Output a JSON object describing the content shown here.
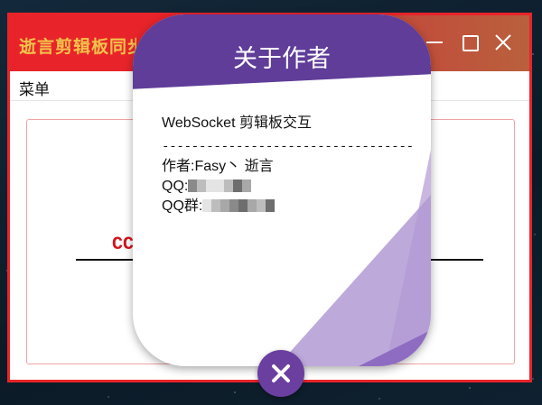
{
  "app": {
    "title": "逝言剪辑板同步",
    "menu": {
      "label": "菜单"
    },
    "content": {
      "text": "CC"
    }
  },
  "about": {
    "title": "关于作者",
    "app_name": "WebSocket 剪辑板交互",
    "divider": "------------------------------------",
    "author": "作者:Fasy丶 逝言",
    "qq_label": "QQ:",
    "qq_group_label": "QQ群:"
  },
  "colors": {
    "titlebar": "#e8242a",
    "dialog_header": "#5f3d99",
    "close_button": "#6a3fa0",
    "title_text": "#f2c34a"
  },
  "icons": {
    "minimize": "minimize-icon",
    "maximize": "maximize-icon",
    "close": "close-icon",
    "dialog_close": "close-icon"
  }
}
